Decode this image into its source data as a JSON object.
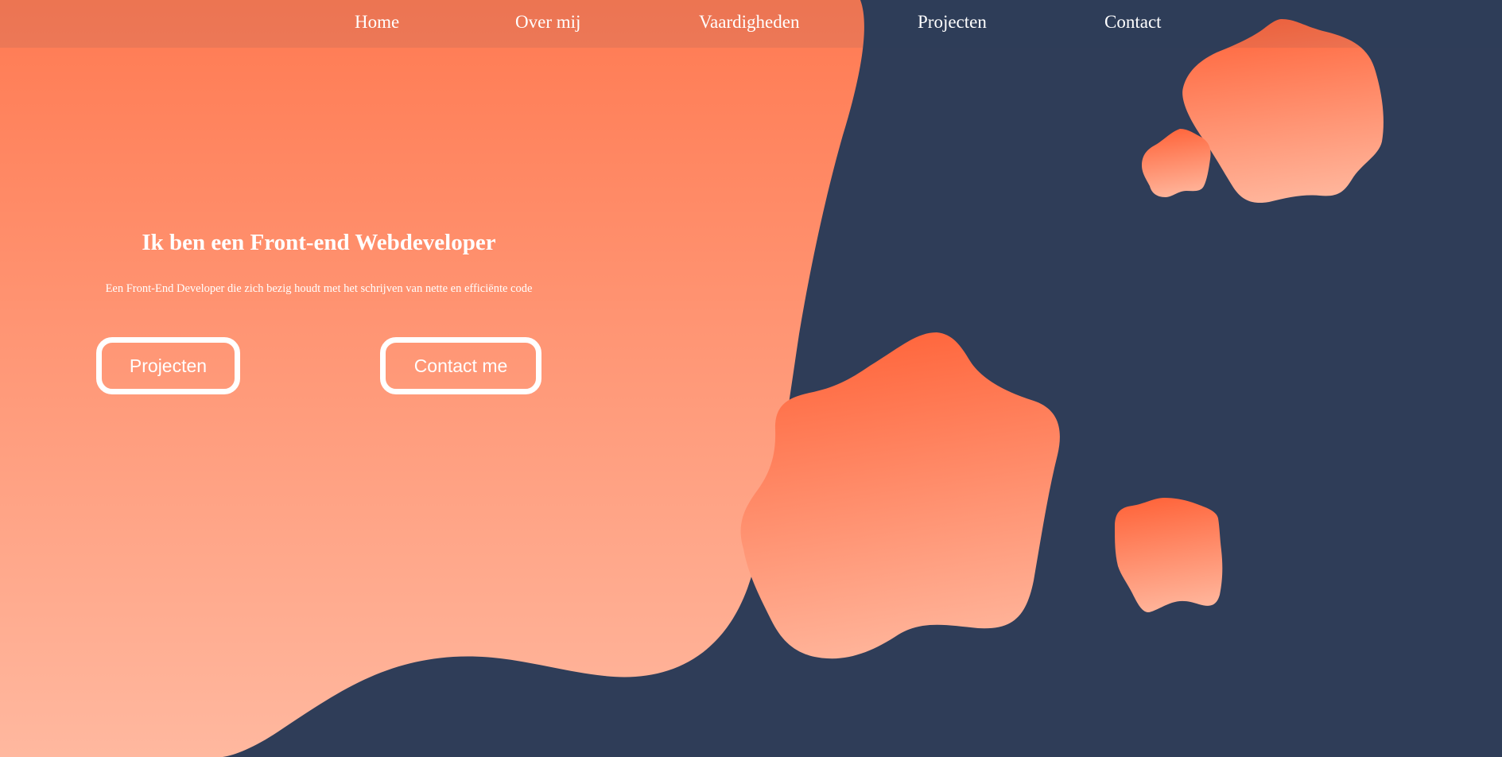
{
  "colors": {
    "background": "#2f3d58",
    "accent": "#ff6a3d",
    "accent_light": "#ffb89f",
    "text": "#ffffff"
  },
  "nav": {
    "items": [
      {
        "label": "Home"
      },
      {
        "label": "Over mij"
      },
      {
        "label": "Vaardigheden"
      },
      {
        "label": "Projecten"
      },
      {
        "label": "Contact"
      }
    ]
  },
  "hero": {
    "title": "Ik ben een Front-end Webdeveloper",
    "subtitle": "Een Front-End Developer die zich bezig houdt met het schrijven van nette en efficiënte code",
    "buttons": {
      "projects": "Projecten",
      "contact": "Contact me"
    }
  }
}
